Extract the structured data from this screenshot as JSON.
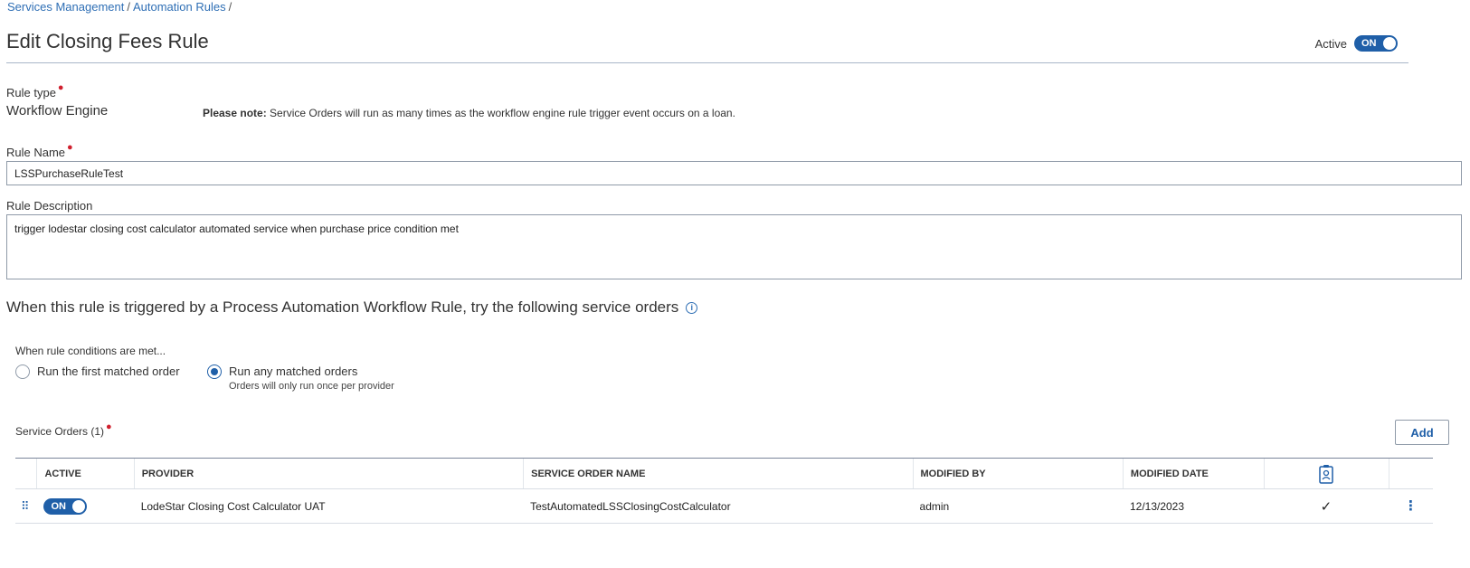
{
  "breadcrumb": {
    "items": [
      "Services Management",
      "Automation Rules"
    ],
    "separator": "/"
  },
  "page": {
    "title": "Edit Closing Fees Rule",
    "active_label": "Active",
    "active_toggle": "ON"
  },
  "rule_type": {
    "label": "Rule type",
    "value": "Workflow Engine",
    "note_bold": "Please note:",
    "note_text": " Service Orders will run as many times as the workflow engine rule trigger event occurs on a loan."
  },
  "rule_name": {
    "label": "Rule Name",
    "value": "LSSPurchaseRuleTest"
  },
  "rule_description": {
    "label": "Rule Description",
    "value": "trigger lodestar closing cost calculator automated service when purchase price condition met"
  },
  "section_heading": "When this rule is triggered by a Process Automation Workflow Rule, try the following service orders",
  "conditions": {
    "label": "When rule conditions are met...",
    "options": [
      {
        "label": "Run the first matched order",
        "sub": "",
        "selected": false
      },
      {
        "label": "Run any matched orders",
        "sub": "Orders will only run once per provider",
        "selected": true
      }
    ]
  },
  "service_orders": {
    "label": "Service Orders (1)",
    "add_label": "Add",
    "columns": [
      "ACTIVE",
      "PROVIDER",
      "SERVICE ORDER NAME",
      "MODIFIED BY",
      "MODIFIED DATE"
    ],
    "rows": [
      {
        "active": "ON",
        "provider": "LodeStar Closing Cost Calculator UAT",
        "name": "TestAutomatedLSSClosingCostCalculator",
        "modified_by": "admin",
        "modified_date": "12/13/2023",
        "flag_icon": "check-icon"
      }
    ]
  },
  "colors": {
    "accent": "#1f5fa8",
    "link": "#2f6fb5",
    "required": "#d0202e"
  }
}
